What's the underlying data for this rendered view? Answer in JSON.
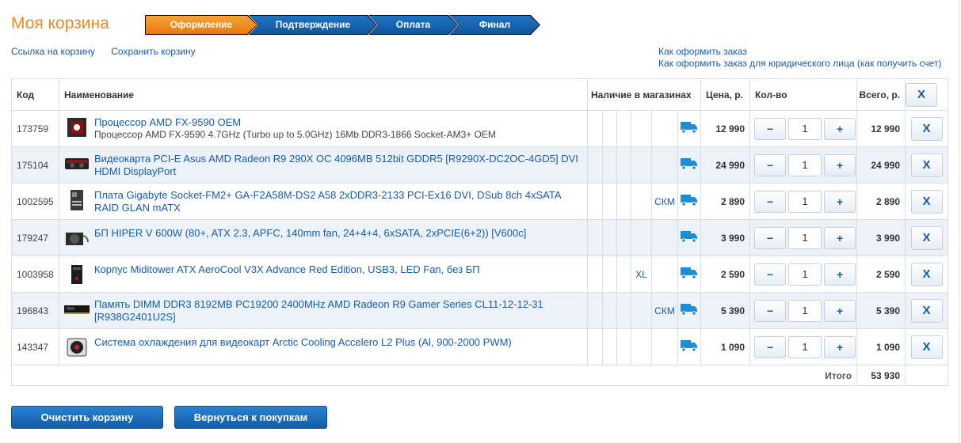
{
  "header": {
    "title": "Моя корзина",
    "steps": [
      "Оформление",
      "Подтверждение",
      "Оплата",
      "Финал"
    ],
    "active_step": 0
  },
  "links": {
    "cart_link": "Ссылка на корзину",
    "save_cart": "Сохранить корзину",
    "how_to_order": "Как оформить заказ",
    "how_to_order_legal": "Как оформить заказ для юридического лица (как получить счет)"
  },
  "table": {
    "headers": {
      "code": "Код",
      "name": "Наименование",
      "stores": "Наличие в магазинах",
      "price": "Цена, р.",
      "qty": "Кол-во",
      "total": "Всего, р.",
      "remove": "X"
    },
    "rows": [
      {
        "code": "173759",
        "name": "Процессор AMD FX-9590 OEM",
        "desc": "Процессор AMD FX-9590 4.7GHz (Turbo up to 5.0GHz) 16Mb DDR3-1866 Socket-AM3+ OEM",
        "store": "",
        "price": "12 990",
        "qty": "1",
        "total": "12 990",
        "thumb": "cpu-thumbnail"
      },
      {
        "code": "175104",
        "name": "Видеокарта PCI-E Asus AMD Radeon R9 290X OC 4096MB 512bit GDDR5 [R9290X-DC2OC-4GD5] DVI HDMI DisplayPort",
        "desc": "",
        "store": "",
        "price": "24 990",
        "qty": "1",
        "total": "24 990",
        "thumb": "gpu-thumbnail"
      },
      {
        "code": "1002595",
        "name": "Плата Gigabyte Socket-FM2+ GA-F2A58M-DS2 A58 2xDDR3-2133 PCI-Ex16 DVI, DSub 8ch 4xSATA RAID GLAN mATX",
        "desc": "",
        "store": "СКМ",
        "price": "2 890",
        "qty": "1",
        "total": "2 890",
        "thumb": "motherboard-thumbnail"
      },
      {
        "code": "179247",
        "name": "БП HIPER V 600W (80+, ATX 2.3, APFC, 140mm fan, 24+4+4, 6xSATA, 2xPCIE(6+2)) [V600c]",
        "desc": "",
        "store": "",
        "price": "3 990",
        "qty": "1",
        "total": "3 990",
        "thumb": "psu-thumbnail"
      },
      {
        "code": "1003958",
        "name": "Корпус Miditower ATX AeroCool V3X Advance Red Edition, USB3, LED Fan, без БП",
        "desc": "",
        "store": "XL",
        "price": "2 590",
        "qty": "1",
        "total": "2 590",
        "thumb": "case-thumbnail"
      },
      {
        "code": "196843",
        "name": "Память DIMM DDR3 8192MB PC19200 2400MHz AMD Radeon R9 Gamer Series CL11-12-12-31 [R938G2401U2S]",
        "desc": "",
        "store": "СКМ",
        "price": "5 390",
        "qty": "1",
        "total": "5 390",
        "thumb": "ram-thumbnail"
      },
      {
        "code": "143347",
        "name": "Система охлаждения для видеокарт Arctic Cooling Accelero L2 Plus (Al, 900-2000 PWM)",
        "desc": "",
        "store": "",
        "price": "1 090",
        "qty": "1",
        "total": "1 090",
        "thumb": "cooler-thumbnail"
      }
    ],
    "total_label": "Итого",
    "total_value": "53 930",
    "minus": "−",
    "plus": "+"
  },
  "buttons": {
    "clear": "Очистить корзину",
    "back": "Вернуться к покупкам"
  },
  "colors": {
    "accent_orange": "#f08a24",
    "link_blue": "#1a5aa6",
    "button_blue": "#1a6fc0",
    "truck_blue": "#1a8fd6"
  }
}
